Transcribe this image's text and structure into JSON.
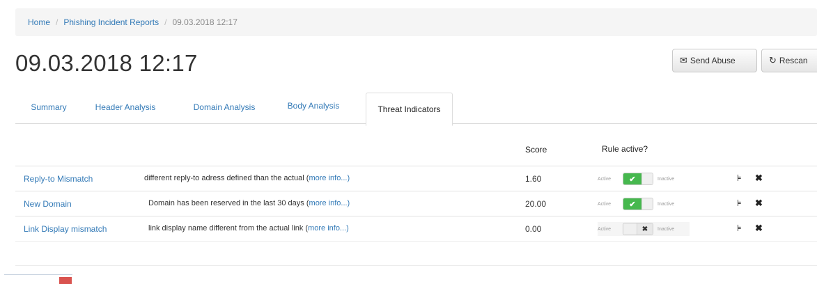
{
  "breadcrumb": {
    "home": "Home",
    "separator": "/",
    "reports": "Phishing Incident Reports",
    "current": "09.03.2018 12:17"
  },
  "page": {
    "title": "09.03.2018 12:17"
  },
  "actions": {
    "send_abuse": "Send Abuse",
    "send_abuse_icon": "envelope-icon",
    "rescan": "Rescan",
    "rescan_icon": "refresh-icon"
  },
  "tabs": [
    {
      "label": "Summary",
      "active": false
    },
    {
      "label": "Header Analysis",
      "active": false
    },
    {
      "label": "Domain Analysis",
      "active": false
    },
    {
      "label": "Body Analysis",
      "active": false
    },
    {
      "label": "Threat Indicators",
      "active": true
    }
  ],
  "table": {
    "headers": {
      "score": "Score",
      "rule_active": "Rule active?"
    },
    "switch_labels": {
      "on": "Active",
      "off": "Inactive"
    },
    "rows": [
      {
        "name": "Reply-to Mismatch",
        "description": "different reply-to adress defined than the actual (",
        "more": "more info...)",
        "score": "1.60",
        "active": true
      },
      {
        "name": "New Domain",
        "description": "Domain has been reserved in the last 30 days   (",
        "more": "more info...)",
        "score": "20.00",
        "active": true
      },
      {
        "name": "Link Display mismatch",
        "description": "link display name different from the actual link (",
        "more": "more info...)",
        "score": "0.00",
        "active": false
      }
    ]
  },
  "colors": {
    "link": "#337ab7",
    "switch_on": "#46b84e",
    "delete_mark": "#d9534f"
  }
}
